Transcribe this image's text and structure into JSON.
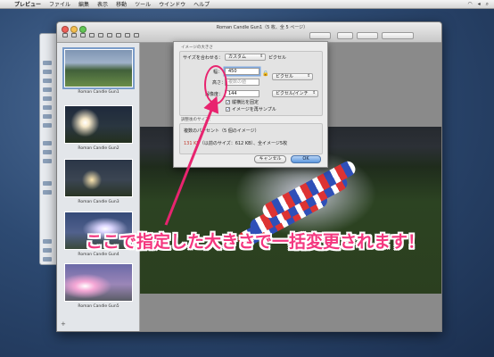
{
  "menubar": {
    "apple": "",
    "items": [
      "プレビュー",
      "ファイル",
      "編集",
      "表示",
      "移動",
      "ツール",
      "ウインドウ",
      "ヘルプ"
    ]
  },
  "window": {
    "title": "Roman Candle Gun1（5 枚、全 5 ページ）"
  },
  "sidebar": {
    "thumbnails": [
      {
        "caption": "Roman Candle Gun1",
        "selected": true
      },
      {
        "caption": "Roman Candle Gun2",
        "selected": false
      },
      {
        "caption": "Roman Candle Gun3",
        "selected": false
      },
      {
        "caption": "Roman Candle Gun4",
        "selected": false
      },
      {
        "caption": "Roman Candle Gun5",
        "selected": false
      }
    ],
    "add_icon": "+"
  },
  "dialog": {
    "image_dims_label": "イメージの大きさ",
    "fit_label": "サイズを合わせる：",
    "fit_value": "カスタム",
    "fit_unit": "ピクセル",
    "width_label": "幅：",
    "width_value": "450",
    "height_label": "高さ：",
    "height_placeholder": "複数の値",
    "unit_value": "ピクセル",
    "resolution_label": "解像度：",
    "resolution_value": "144",
    "resolution_unit": "ピクセル/インチ",
    "scale_proportional_label": "縦横比を固定",
    "resample_label": "イメージを再サンプル",
    "result_label": "調整後のサイズ：",
    "result_percent": "複数のパーセント（5 個のイメージ）",
    "result_size_red": "131 KB",
    "result_size_rest": "（以前のサイズ：612 KB）、全イメージ5枚",
    "cancel_button": "キャンセル",
    "ok_button": "OK"
  },
  "annotation": {
    "caption": "ここで指定した大きさで一括変更されます！",
    "color": "#f4377f"
  }
}
